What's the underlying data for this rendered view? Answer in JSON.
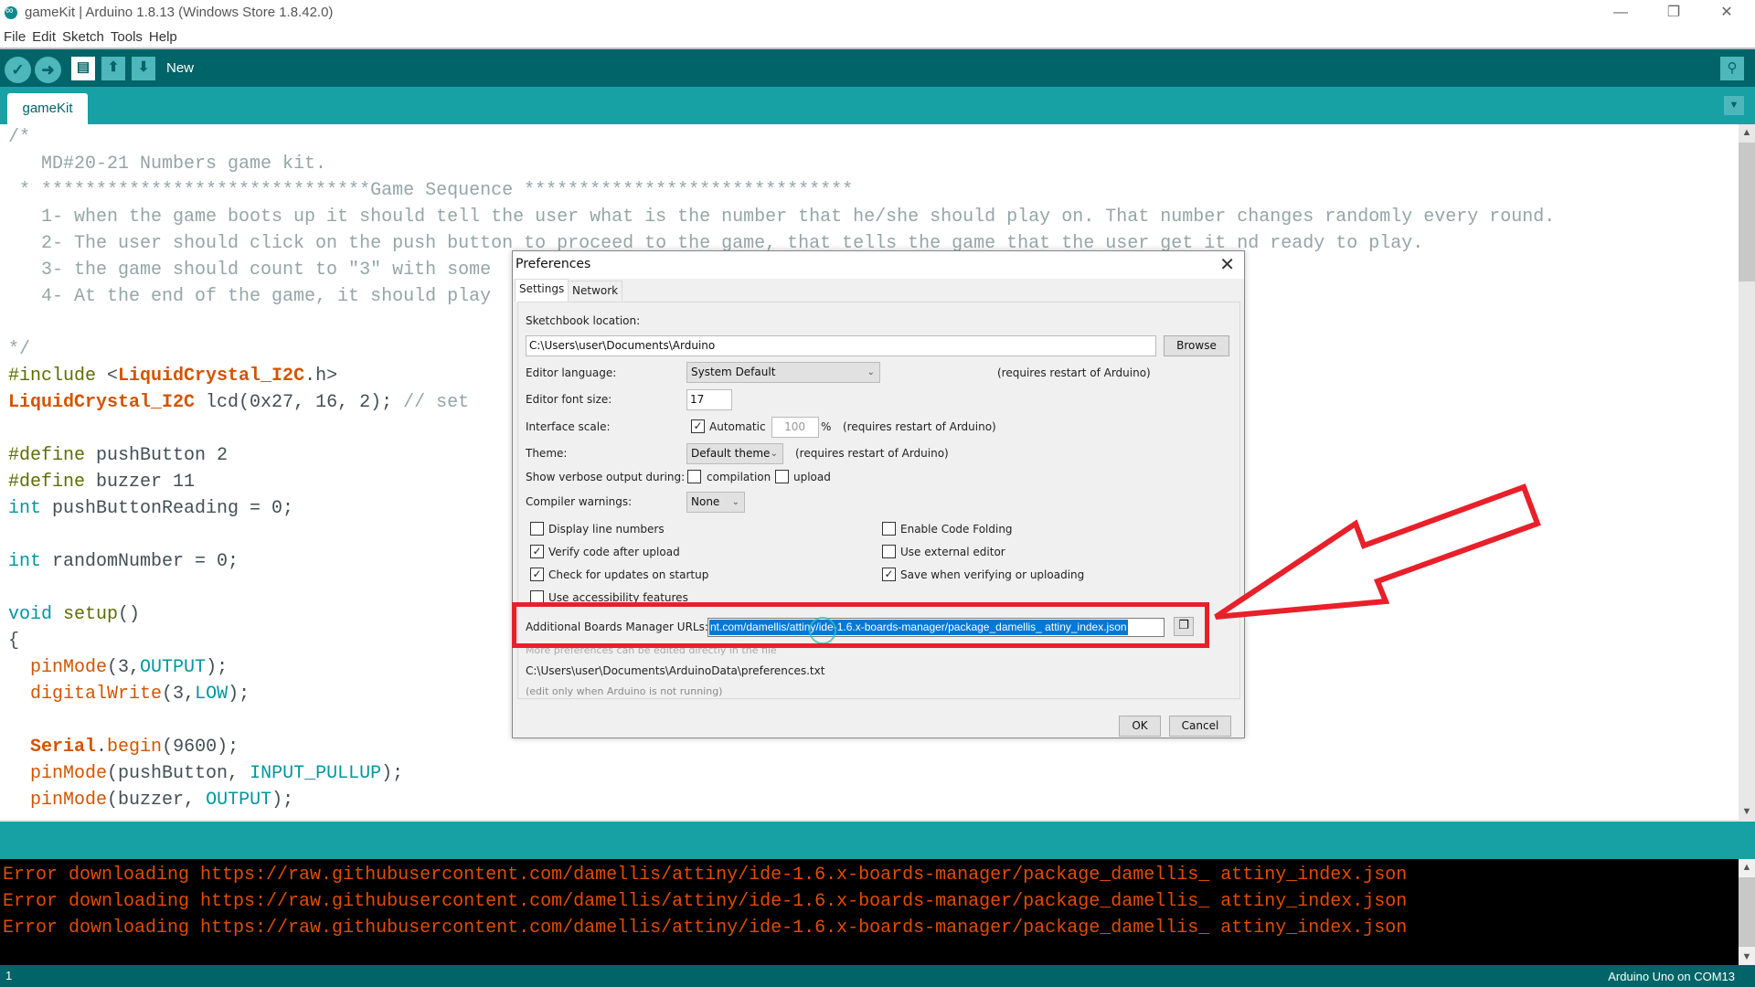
{
  "window": {
    "title": "gameKit | Arduino 1.8.13 (Windows Store 1.8.42.0)",
    "minimize": "—",
    "maximize": "❐",
    "close": "✕"
  },
  "menu": [
    "File",
    "Edit",
    "Sketch",
    "Tools",
    "Help"
  ],
  "toolbar": {
    "verify_icon": "✓",
    "upload_icon": "➜",
    "new_icon": "▤",
    "open_icon": "⬆",
    "save_icon": "⬇",
    "hover_label": "New",
    "serial_monitor_icon": "⚲"
  },
  "tabs": {
    "active": "gameKit",
    "menu_icon": "▼"
  },
  "editor": {
    "lines": [
      {
        "parts": [
          {
            "t": "/*",
            "c": "cm"
          }
        ]
      },
      {
        "parts": [
          {
            "t": "   MD#20-21 Numbers game kit.",
            "c": "cm"
          }
        ]
      },
      {
        "parts": [
          {
            "t": " * ******************************Game Sequence ******************************",
            "c": "cm"
          }
        ]
      },
      {
        "parts": [
          {
            "t": "   1- when the game boots up it should tell the user what is the number that he/she should play on. That number changes randomly every round.",
            "c": "cm"
          }
        ]
      },
      {
        "parts": [
          {
            "t": "   2- The user should click on the push button to proceed to the game, that tells the game that the user get it nd ready to play.",
            "c": "cm"
          }
        ]
      },
      {
        "parts": [
          {
            "t": "   3- the game should count to \"3\" with some",
            "c": "cm"
          }
        ]
      },
      {
        "parts": [
          {
            "t": "   4- At the end of the game, it should play",
            "c": "cm"
          }
        ]
      },
      {
        "parts": []
      },
      {
        "parts": [
          {
            "t": "*/",
            "c": "cm"
          }
        ]
      },
      {
        "parts": [
          {
            "t": "#include",
            "c": "kw-pre"
          },
          {
            "t": " <",
            "c": ""
          },
          {
            "t": "LiquidCrystal_I2C",
            "c": "kw-lib"
          },
          {
            "t": ".h>",
            "c": ""
          }
        ]
      },
      {
        "parts": [
          {
            "t": "LiquidCrystal_I2C",
            "c": "kw-lib"
          },
          {
            "t": " lcd(0x27, 16, 2); ",
            "c": ""
          },
          {
            "t": "// set",
            "c": "cm"
          }
        ]
      },
      {
        "parts": []
      },
      {
        "parts": [
          {
            "t": "#define",
            "c": "kw-pre"
          },
          {
            "t": " pushButton 2",
            "c": ""
          }
        ]
      },
      {
        "parts": [
          {
            "t": "#define",
            "c": "kw-pre"
          },
          {
            "t": " buzzer 11",
            "c": ""
          }
        ]
      },
      {
        "parts": [
          {
            "t": "int",
            "c": "kw-type"
          },
          {
            "t": " pushButtonReading = 0;",
            "c": ""
          }
        ]
      },
      {
        "parts": []
      },
      {
        "parts": [
          {
            "t": "int",
            "c": "kw-type"
          },
          {
            "t": " randomNumber = 0;",
            "c": ""
          }
        ]
      },
      {
        "parts": []
      },
      {
        "parts": [
          {
            "t": "void",
            "c": "kw-type"
          },
          {
            "t": " ",
            "c": ""
          },
          {
            "t": "setup",
            "c": "kw-pre"
          },
          {
            "t": "()",
            "c": ""
          }
        ]
      },
      {
        "parts": [
          {
            "t": "{",
            "c": ""
          }
        ]
      },
      {
        "parts": [
          {
            "t": "  ",
            "c": ""
          },
          {
            "t": "pinMode",
            "c": "kw-fn"
          },
          {
            "t": "(3,",
            "c": ""
          },
          {
            "t": "OUTPUT",
            "c": "kw-const"
          },
          {
            "t": ");",
            "c": ""
          }
        ]
      },
      {
        "parts": [
          {
            "t": "  ",
            "c": ""
          },
          {
            "t": "digitalWrite",
            "c": "kw-fn"
          },
          {
            "t": "(3,",
            "c": ""
          },
          {
            "t": "LOW",
            "c": "kw-const"
          },
          {
            "t": ");",
            "c": ""
          }
        ]
      },
      {
        "parts": []
      },
      {
        "parts": [
          {
            "t": "  ",
            "c": ""
          },
          {
            "t": "Serial",
            "c": "kw-lib"
          },
          {
            "t": ".",
            "c": ""
          },
          {
            "t": "begin",
            "c": "kw-fn"
          },
          {
            "t": "(9600);",
            "c": ""
          }
        ]
      },
      {
        "parts": [
          {
            "t": "  ",
            "c": ""
          },
          {
            "t": "pinMode",
            "c": "kw-fn"
          },
          {
            "t": "(pushButton, ",
            "c": ""
          },
          {
            "t": "INPUT_PULLUP",
            "c": "kw-const"
          },
          {
            "t": ");",
            "c": ""
          }
        ]
      },
      {
        "parts": [
          {
            "t": "  ",
            "c": ""
          },
          {
            "t": "pinMode",
            "c": "kw-fn"
          },
          {
            "t": "(buzzer, ",
            "c": ""
          },
          {
            "t": "OUTPUT",
            "c": "kw-const"
          },
          {
            "t": ");",
            "c": ""
          }
        ]
      }
    ]
  },
  "console": {
    "lines": [
      "Error downloading https://raw.githubusercontent.com/damellis/attiny/ide-1.6.x-boards-manager/package_damellis_ attiny_index.json",
      "Error downloading https://raw.githubusercontent.com/damellis/attiny/ide-1.6.x-boards-manager/package_damellis_ attiny_index.json",
      "Error downloading https://raw.githubusercontent.com/damellis/attiny/ide-1.6.x-boards-manager/package_damellis_ attiny_index.json"
    ],
    "color": "#e34c00"
  },
  "status": {
    "line_number": "1",
    "board": "Arduino Uno on COM13"
  },
  "preferences": {
    "title": "Preferences",
    "close": "✕",
    "tabs": [
      "Settings",
      "Network"
    ],
    "sketchbook_label": "Sketchbook location:",
    "sketchbook_value": "C:\\Users\\user\\Documents\\Arduino",
    "browse": "Browse",
    "editor_language_label": "Editor language:",
    "editor_language_value": "System Default",
    "restart_note": "(requires restart of Arduino)",
    "font_size_label": "Editor font size:",
    "font_size_value": "17",
    "interface_scale_label": "Interface scale:",
    "interface_scale_auto": "Automatic",
    "interface_scale_auto_checked": true,
    "interface_scale_value": "100",
    "percent": "%",
    "theme_label": "Theme:",
    "theme_value": "Default theme",
    "verbose_label": "Show verbose output during:",
    "verbose_compilation": "compilation",
    "verbose_compilation_checked": false,
    "verbose_upload": "upload",
    "verbose_upload_checked": false,
    "compiler_warnings_label": "Compiler warnings:",
    "compiler_warnings_value": "None",
    "checkboxes_left": [
      {
        "label": "Display line numbers",
        "checked": false
      },
      {
        "label": "Verify code after upload",
        "checked": true
      },
      {
        "label": "Check for updates on startup",
        "checked": true
      },
      {
        "label": "Use accessibility features",
        "checked": false
      }
    ],
    "checkboxes_right": [
      {
        "label": "Enable Code Folding",
        "checked": false
      },
      {
        "label": "Use external editor",
        "checked": false
      },
      {
        "label": "Save when verifying or uploading",
        "checked": true
      }
    ],
    "boards_urls_label": "Additional Boards Manager URLs:",
    "boards_urls_value": "nt.com/damellis/attiny/ide-1.6.x-boards-manager/package_damellis_ attiny_index.json",
    "more_prefs_note": "More preferences can be edited directly in the file",
    "prefs_path": "C:\\Users\\user\\Documents\\ArduinoData\\preferences.txt",
    "edit_note": "(edit only when Arduino is not running)",
    "ok": "OK",
    "cancel": "Cancel"
  },
  "annotation": {
    "highlight_color": "#e8202a"
  }
}
